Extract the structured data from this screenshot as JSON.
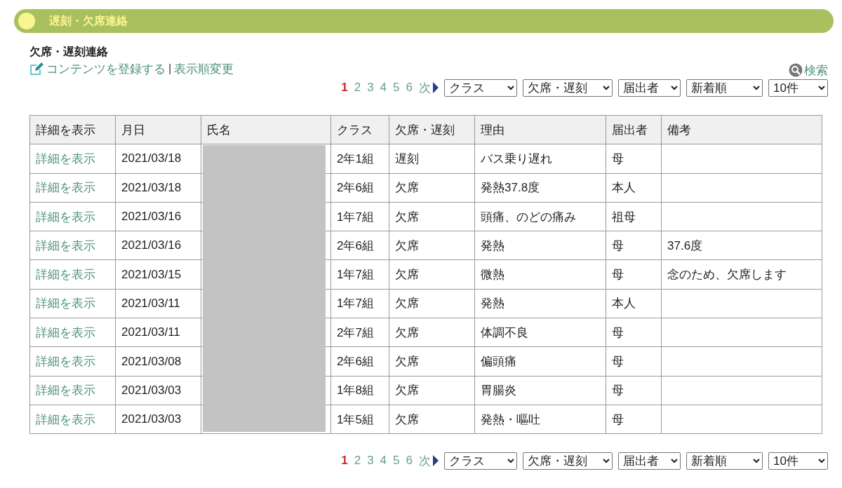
{
  "header": {
    "title": "遅刻・欠席連絡"
  },
  "section_title": "欠席・遅刻連絡",
  "actions": {
    "register_link": "コンテンツを登録する",
    "separator": "|",
    "reorder_link": "表示順変更"
  },
  "search_link": "検索",
  "pagination_top": {
    "pages": [
      {
        "label": "1",
        "selected": true
      },
      {
        "label": "2",
        "selected": false
      },
      {
        "label": "3",
        "selected": false
      },
      {
        "label": "4",
        "selected": false
      },
      {
        "label": "5",
        "selected": false
      },
      {
        "label": "6",
        "selected": false
      }
    ],
    "next": "次",
    "filters": [
      "クラス",
      "欠席・遅刻",
      "届出者",
      "新着順",
      "10件"
    ]
  },
  "table": {
    "columns": [
      "詳細を表示",
      "月日",
      "氏名",
      "クラス",
      "欠席・遅刻",
      "理由",
      "届出者",
      "備考"
    ],
    "rows": [
      {
        "detail_link": "詳細を表示",
        "date": "2021/03/18",
        "class": "2年1組",
        "type": "遅刻",
        "reason": "バス乗り遅れ",
        "reporter": "母"
      },
      {
        "detail_link": "詳細を表示",
        "date": "2021/03/18",
        "class": "2年6組",
        "type": "欠席",
        "reason": "発熱37.8度",
        "reporter": "本人"
      },
      {
        "detail_link": "詳細を表示",
        "date": "2021/03/16",
        "class": "1年7組",
        "type": "欠席",
        "reason": "頭痛、のどの痛み",
        "reporter": "祖母"
      },
      {
        "detail_link": "詳細を表示",
        "date": "2021/03/16",
        "class": "2年6組",
        "type": "欠席",
        "reason": "発熱",
        "reporter": "母",
        "note": "37.6度"
      },
      {
        "detail_link": "詳細を表示",
        "date": "2021/03/15",
        "class": "1年7組",
        "type": "欠席",
        "reason": "微熱",
        "reporter": "母",
        "note": "念のため、欠席します"
      },
      {
        "detail_link": "詳細を表示",
        "date": "2021/03/11",
        "class": "1年7組",
        "type": "欠席",
        "reason": "発熱",
        "reporter": "本人"
      },
      {
        "detail_link": "詳細を表示",
        "date": "2021/03/11",
        "class": "2年7組",
        "type": "欠席",
        "reason": "体調不良",
        "reporter": "母"
      },
      {
        "detail_link": "詳細を表示",
        "date": "2021/03/08",
        "class": "2年6組",
        "type": "欠席",
        "reason": "偏頭痛",
        "reporter": "母"
      },
      {
        "detail_link": "詳細を表示",
        "date": "2021/03/03",
        "class": "1年8組",
        "type": "欠席",
        "reason": "胃腸炎",
        "reporter": "母"
      },
      {
        "detail_link": "詳細を表示",
        "date": "2021/03/03",
        "class": "1年5組",
        "type": "欠席",
        "reason": "発熱・嘔吐",
        "reporter": "母"
      }
    ]
  },
  "pagination_bottom": {
    "pages": [
      {
        "label": "1",
        "selected": true
      },
      {
        "label": "2",
        "selected": false
      },
      {
        "label": "3",
        "selected": false
      },
      {
        "label": "4",
        "selected": false
      },
      {
        "label": "5",
        "selected": false
      },
      {
        "label": "6",
        "selected": false
      }
    ],
    "next": "次",
    "filters": [
      "クラス",
      "欠席・遅刻",
      "届出者",
      "新着順",
      "10件"
    ]
  }
}
